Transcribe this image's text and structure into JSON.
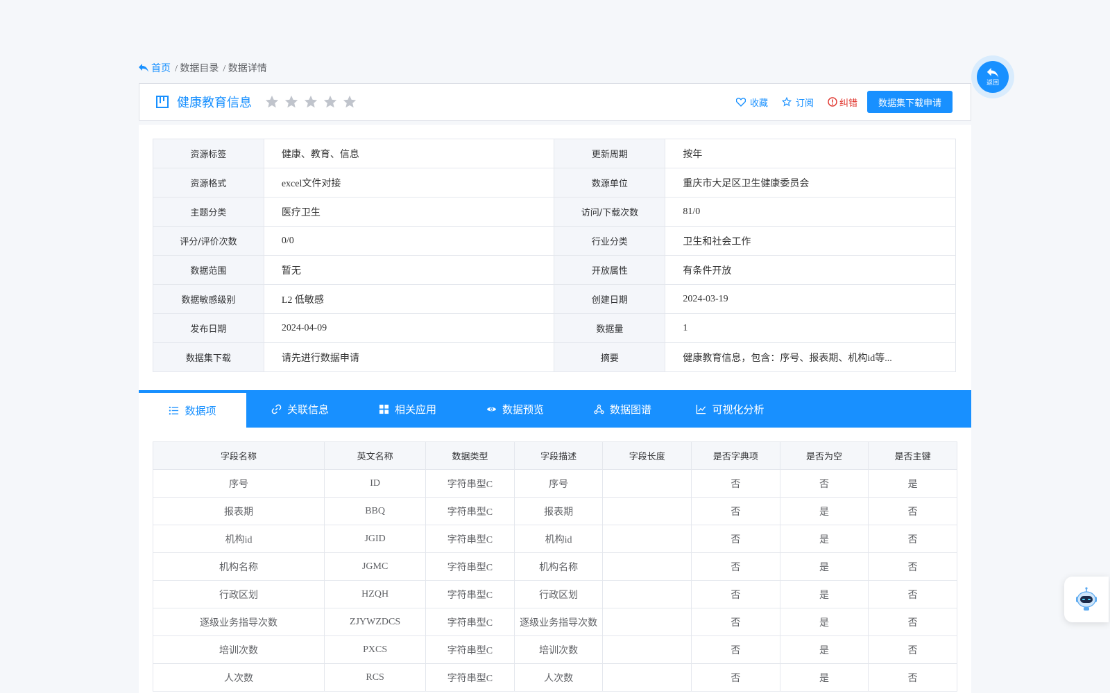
{
  "breadcrumb": {
    "home": "首页",
    "catalog": "/ 数据目录",
    "detail": "/ 数据详情"
  },
  "header": {
    "title": "健康教育信息",
    "rating_stars": 0,
    "favorite": "收藏",
    "subscribe": "订阅",
    "correct": "纠错",
    "apply_button": "数据集下载申请"
  },
  "info": {
    "rows": [
      {
        "l1": "资源标签",
        "v1": "健康、教育、信息",
        "l2": "更新周期",
        "v2": "按年"
      },
      {
        "l1": "资源格式",
        "v1": "excel文件对接",
        "l2": "数源单位",
        "v2": "重庆市大足区卫生健康委员会"
      },
      {
        "l1": "主题分类",
        "v1": "医疗卫生",
        "l2": "访问/下载次数",
        "v2": "81/0"
      },
      {
        "l1": "评分/评价次数",
        "v1": "0/0",
        "l2": "行业分类",
        "v2": "卫生和社会工作"
      },
      {
        "l1": "数据范围",
        "v1": "暂无",
        "l2": "开放属性",
        "v2": "有条件开放"
      },
      {
        "l1": "数据敏感级别",
        "v1": "L2 低敏感",
        "l2": "创建日期",
        "v2": "2024-03-19"
      },
      {
        "l1": "发布日期",
        "v1": "2024-04-09",
        "l2": "数据量",
        "v2": "1"
      },
      {
        "l1": "数据集下载",
        "v1": "请先进行数据申请",
        "l2": "摘要",
        "v2": "健康教育信息，包含：序号、报表期、机构id等..."
      }
    ]
  },
  "tabs": [
    {
      "label": "数据项",
      "icon": "list-icon"
    },
    {
      "label": "关联信息",
      "icon": "link-icon"
    },
    {
      "label": "相关应用",
      "icon": "apps-icon"
    },
    {
      "label": "数据预览",
      "icon": "eye-icon"
    },
    {
      "label": "数据图谱",
      "icon": "graph-icon"
    },
    {
      "label": "可视化分析",
      "icon": "line-chart-icon"
    }
  ],
  "items": {
    "headers": [
      "字段名称",
      "英文名称",
      "数据类型",
      "字段描述",
      "字段长度",
      "是否字典项",
      "是否为空",
      "是否主键"
    ],
    "rows": [
      [
        "序号",
        "ID",
        "字符串型C",
        "序号",
        "",
        "否",
        "否",
        "是"
      ],
      [
        "报表期",
        "BBQ",
        "字符串型C",
        "报表期",
        "",
        "否",
        "是",
        "否"
      ],
      [
        "机构id",
        "JGID",
        "字符串型C",
        "机构id",
        "",
        "否",
        "是",
        "否"
      ],
      [
        "机构名称",
        "JGMC",
        "字符串型C",
        "机构名称",
        "",
        "否",
        "是",
        "否"
      ],
      [
        "行政区划",
        "HZQH",
        "字符串型C",
        "行政区划",
        "",
        "否",
        "是",
        "否"
      ],
      [
        "逐级业务指导次数",
        "ZJYWZDCS",
        "字符串型C",
        "逐级业务指导次数",
        "",
        "否",
        "是",
        "否"
      ],
      [
        "培训次数",
        "PXCS",
        "字符串型C",
        "培训次数",
        "",
        "否",
        "是",
        "否"
      ],
      [
        "人次数",
        "RCS",
        "字符串型C",
        "人次数",
        "",
        "否",
        "是",
        "否"
      ]
    ]
  },
  "back_label": "返回",
  "colors": {
    "primary": "#1890ff",
    "danger": "#e0342c",
    "star_empty": "#c0c4cc"
  }
}
